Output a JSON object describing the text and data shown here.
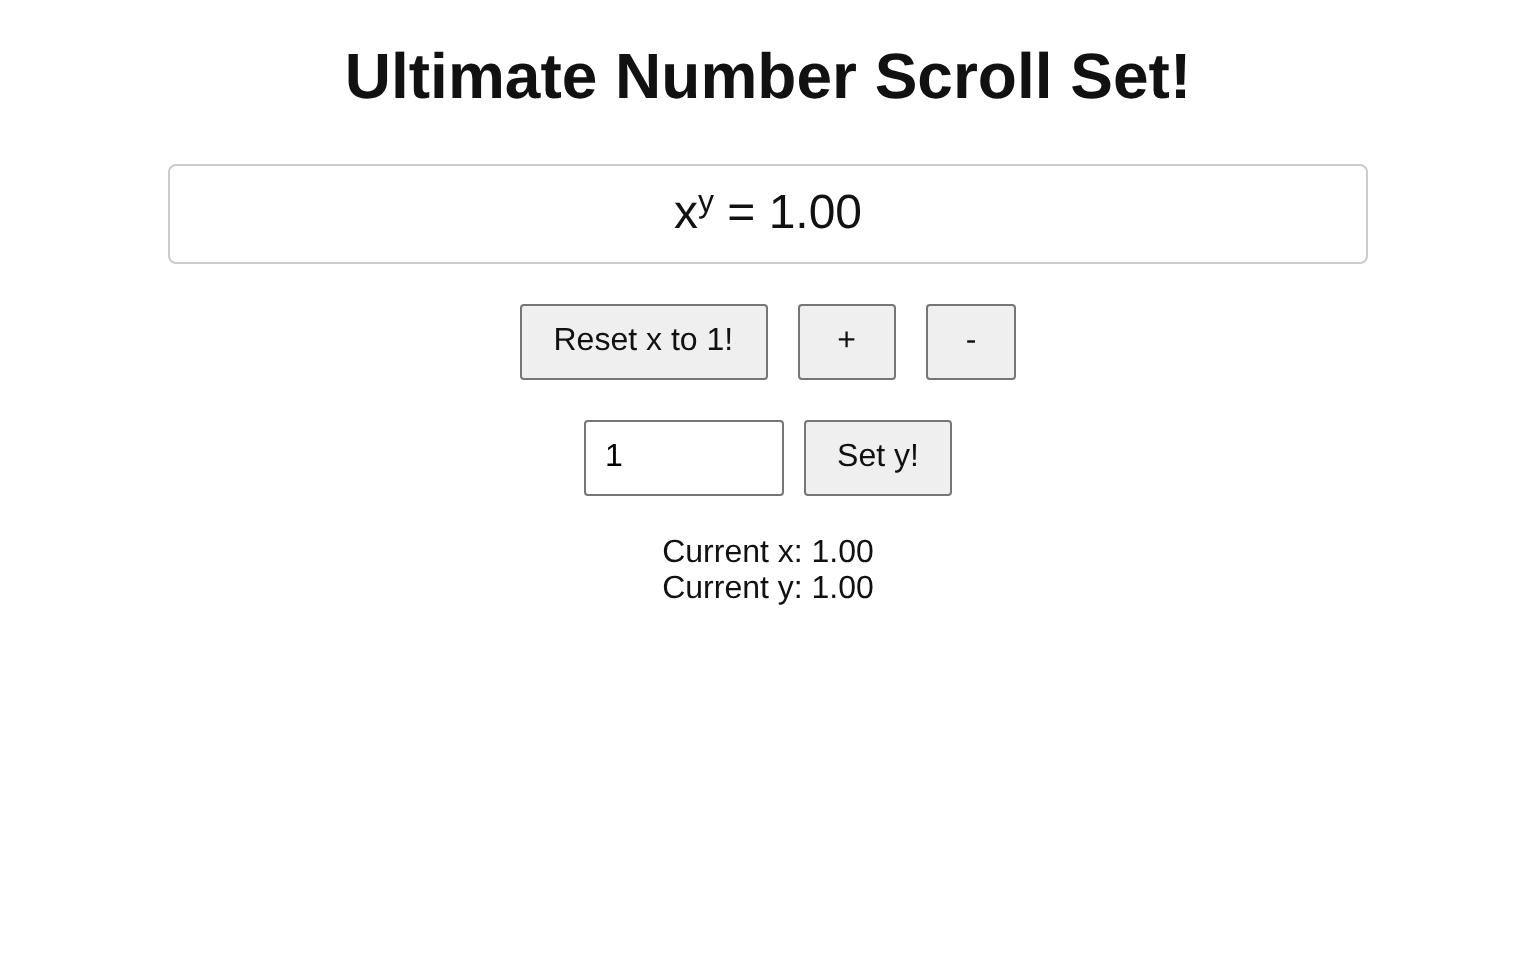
{
  "title": "Ultimate Number Scroll Set!",
  "display": "x$^{y}$ = 1.00",
  "buttons": [
    {
      "label": "Reset x to 1!"
    },
    {
      "label": "+"
    },
    {
      "label": "-"
    }
  ],
  "y_input": {
    "value": "1"
  },
  "set_button": "Set y!",
  "readouts": [
    "Current x: 1.00",
    "Current y: 1.00"
  ]
}
